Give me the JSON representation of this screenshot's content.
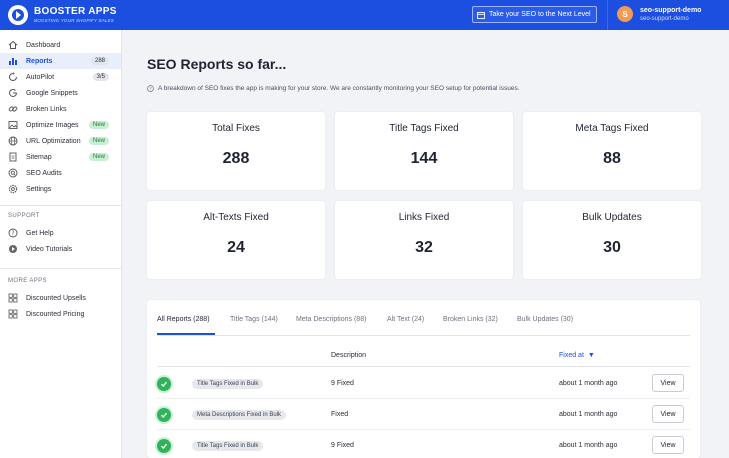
{
  "brand": {
    "name": "BOOSTER APPS",
    "tagline": "BOOSTING YOUR SHOPIFY SALES"
  },
  "header": {
    "cta_label": "Take your SEO to the Next Level",
    "user": {
      "initial": "S",
      "name": "seo-support-demo",
      "store": "seo-support-demo"
    }
  },
  "sidebar": {
    "items": [
      {
        "label": "Dashboard",
        "icon": "home-icon"
      },
      {
        "label": "Reports",
        "icon": "chart-icon",
        "badge": "288",
        "active": true
      },
      {
        "label": "AutoPilot",
        "icon": "autopilot-icon",
        "badge": "3/5"
      },
      {
        "label": "Google Snippets",
        "icon": "google-icon"
      },
      {
        "label": "Broken Links",
        "icon": "link-icon"
      },
      {
        "label": "Optimize Images",
        "icon": "image-icon",
        "badge": "New"
      },
      {
        "label": "URL Optimization",
        "icon": "globe-icon",
        "badge": "New"
      },
      {
        "label": "Sitemap",
        "icon": "document-icon",
        "badge": "New"
      },
      {
        "label": "SEO Audits",
        "icon": "search-icon"
      },
      {
        "label": "Settings",
        "icon": "gear-icon"
      }
    ],
    "support_title": "SUPPORT",
    "support_items": [
      {
        "label": "Get Help",
        "icon": "help-icon"
      },
      {
        "label": "Video Tutorials",
        "icon": "play-icon"
      }
    ],
    "more_title": "MORE APPS",
    "more_items": [
      {
        "label": "Discounted Upsells",
        "icon": "apps-icon"
      },
      {
        "label": "Discounted Pricing",
        "icon": "apps-icon"
      }
    ]
  },
  "main": {
    "title": "SEO Reports so far...",
    "description": "A breakdown of SEO fixes the app is making for your store. We are constantly monitoring your SEO setup for potential issues.",
    "cards": [
      {
        "label": "Total Fixes",
        "value": "288"
      },
      {
        "label": "Title Tags Fixed",
        "value": "144"
      },
      {
        "label": "Meta Tags Fixed",
        "value": "88"
      },
      {
        "label": "Alt-Texts Fixed",
        "value": "24"
      },
      {
        "label": "Links Fixed",
        "value": "32"
      },
      {
        "label": "Bulk Updates",
        "value": "30"
      }
    ],
    "tabs": [
      "All Reports (288)",
      "Title Tags (144)",
      "Meta Descriptions (88)",
      "Alt Text (24)",
      "Broken Links (32)",
      "Bulk Updates (30)"
    ],
    "table": {
      "headers": {
        "description": "Description",
        "fixed_at": "Fixed at",
        "sort_arrow": "▼"
      },
      "rows": [
        {
          "type": "Title Tags Fixed in Bulk",
          "description": "9 Fixed",
          "fixed_at": "about 1 month ago",
          "action": "View"
        },
        {
          "type": "Meta Descriptions Fixed in Bulk",
          "description": "Fixed",
          "fixed_at": "about 1 month ago",
          "action": "View"
        },
        {
          "type": "Title Tags Fixed in Bulk",
          "description": "9 Fixed",
          "fixed_at": "about 1 month ago",
          "action": "View"
        }
      ]
    }
  },
  "colors": {
    "brand_blue": "#1c4fe0",
    "success_green": "#2fb45a",
    "badge_new_bg": "#c9efd2",
    "avatar_orange": "#f39a52"
  }
}
